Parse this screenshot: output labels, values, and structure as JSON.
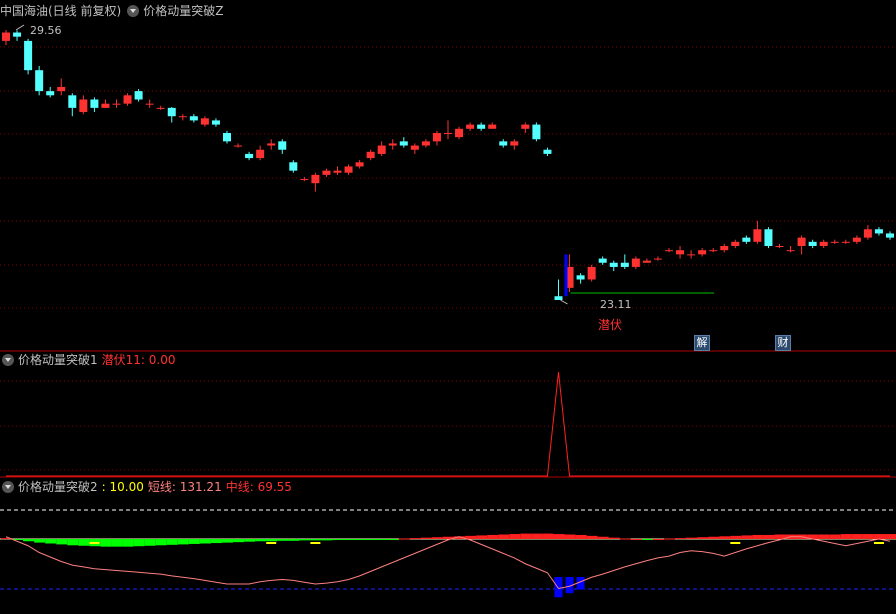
{
  "panel1": {
    "title": "中国海油(日线 前复权)",
    "indicator": "价格动量突破Z",
    "high_label": "29.56",
    "low_label": "23.11",
    "signal_text": "潜伏",
    "event_tags": [
      "解",
      "财"
    ]
  },
  "panel2": {
    "indicator": "价格动量突破1",
    "value_label": "潜伏11: 0.00"
  },
  "panel3": {
    "indicator": "价格动量突破2",
    "v1": ": 10.00",
    "v2_label": "短线: 131.21",
    "v3_label": "中线: 69.55"
  },
  "colors": {
    "up": "#ff3232",
    "down": "#54ffff",
    "bull": "#ff2020",
    "bear": "#00ff00",
    "grid": "#7f0000",
    "short": "#ff8080",
    "blue": "#0000ff"
  },
  "chart_data": [
    {
      "type": "candlestick",
      "ylim": [
        23.11,
        29.56
      ],
      "high": 29.56,
      "low": 23.11,
      "candles": [
        [
          29.3,
          29.5,
          29.2,
          29.56
        ],
        [
          29.5,
          29.4,
          29.3,
          29.55
        ],
        [
          29.3,
          28.6,
          28.5,
          29.35
        ],
        [
          28.6,
          28.1,
          28.0,
          28.7
        ],
        [
          28.1,
          28.0,
          27.95,
          28.2
        ],
        [
          28.1,
          28.2,
          28.0,
          28.4
        ],
        [
          28.0,
          27.7,
          27.5,
          28.05
        ],
        [
          27.6,
          27.9,
          27.55,
          28.0
        ],
        [
          27.9,
          27.7,
          27.6,
          27.95
        ],
        [
          27.7,
          27.8,
          27.7,
          27.9
        ],
        [
          27.8,
          27.8,
          27.7,
          27.9
        ],
        [
          27.8,
          28.0,
          27.75,
          28.05
        ],
        [
          28.1,
          27.9,
          27.85,
          28.15
        ],
        [
          27.8,
          27.8,
          27.7,
          27.9
        ],
        [
          27.7,
          27.7,
          27.65,
          27.75
        ],
        [
          27.7,
          27.5,
          27.35,
          27.72
        ],
        [
          27.5,
          27.5,
          27.4,
          27.55
        ],
        [
          27.5,
          27.4,
          27.35,
          27.55
        ],
        [
          27.3,
          27.45,
          27.25,
          27.5
        ],
        [
          27.4,
          27.3,
          27.25,
          27.45
        ],
        [
          27.1,
          26.9,
          26.85,
          27.15
        ],
        [
          26.8,
          26.8,
          26.75,
          26.85
        ],
        [
          26.6,
          26.5,
          26.45,
          26.65
        ],
        [
          26.5,
          26.7,
          26.45,
          26.8
        ],
        [
          26.8,
          26.85,
          26.7,
          26.95
        ],
        [
          26.9,
          26.7,
          26.6,
          26.95
        ],
        [
          26.4,
          26.2,
          26.15,
          26.45
        ],
        [
          26.0,
          26.0,
          25.95,
          26.05
        ],
        [
          25.9,
          26.1,
          25.7,
          26.15
        ],
        [
          26.1,
          26.2,
          26.05,
          26.25
        ],
        [
          26.15,
          26.2,
          26.1,
          26.3
        ],
        [
          26.15,
          26.3,
          26.1,
          26.35
        ],
        [
          26.3,
          26.4,
          26.25,
          26.45
        ],
        [
          26.5,
          26.65,
          26.45,
          26.7
        ],
        [
          26.6,
          26.8,
          26.55,
          26.9
        ],
        [
          26.8,
          26.85,
          26.7,
          26.95
        ],
        [
          26.9,
          26.8,
          26.75,
          27.0
        ],
        [
          26.7,
          26.8,
          26.6,
          26.85
        ],
        [
          26.8,
          26.9,
          26.75,
          26.95
        ],
        [
          26.9,
          27.1,
          26.8,
          27.15
        ],
        [
          27.1,
          27.1,
          26.95,
          27.4
        ],
        [
          27.0,
          27.2,
          26.95,
          27.25
        ],
        [
          27.2,
          27.3,
          27.15,
          27.35
        ],
        [
          27.3,
          27.2,
          27.15,
          27.35
        ],
        [
          27.2,
          27.3,
          27.2,
          27.35
        ],
        [
          26.9,
          26.8,
          26.75,
          26.95
        ],
        [
          26.8,
          26.9,
          26.7,
          26.95
        ],
        [
          27.2,
          27.3,
          27.1,
          27.35
        ],
        [
          27.3,
          26.95,
          26.9,
          27.35
        ],
        [
          26.7,
          26.6,
          26.55,
          26.75
        ],
        [
          23.2,
          23.11,
          23.11,
          23.6
        ],
        [
          23.4,
          23.9,
          23.3,
          24.2
        ],
        [
          23.7,
          23.6,
          23.5,
          23.75
        ],
        [
          23.6,
          23.9,
          23.55,
          23.95
        ],
        [
          24.1,
          24.0,
          23.95,
          24.15
        ],
        [
          24.0,
          23.9,
          23.8,
          24.05
        ],
        [
          24.0,
          23.9,
          23.85,
          24.2
        ],
        [
          23.9,
          24.1,
          23.85,
          24.15
        ],
        [
          24.0,
          24.05,
          24.0,
          24.1
        ],
        [
          24.1,
          24.1,
          24.05,
          24.15
        ],
        [
          24.3,
          24.3,
          24.25,
          24.35
        ],
        [
          24.2,
          24.3,
          24.1,
          24.4
        ],
        [
          24.2,
          24.2,
          24.1,
          24.3
        ],
        [
          24.2,
          24.3,
          24.15,
          24.35
        ],
        [
          24.3,
          24.3,
          24.25,
          24.35
        ],
        [
          24.3,
          24.4,
          24.25,
          24.45
        ],
        [
          24.4,
          24.5,
          24.35,
          24.55
        ],
        [
          24.6,
          24.5,
          24.45,
          24.65
        ],
        [
          24.5,
          24.8,
          24.45,
          25.0
        ],
        [
          24.8,
          24.4,
          24.35,
          24.85
        ],
        [
          24.4,
          24.4,
          24.35,
          24.45
        ],
        [
          24.3,
          24.3,
          24.25,
          24.4
        ],
        [
          24.4,
          24.6,
          24.2,
          24.65
        ],
        [
          24.5,
          24.4,
          24.35,
          24.55
        ],
        [
          24.4,
          24.5,
          24.35,
          24.55
        ],
        [
          24.5,
          24.5,
          24.45,
          24.55
        ],
        [
          24.5,
          24.5,
          24.45,
          24.55
        ],
        [
          24.5,
          24.6,
          24.45,
          24.65
        ],
        [
          24.6,
          24.8,
          24.55,
          24.9
        ],
        [
          24.8,
          24.7,
          24.65,
          24.85
        ],
        [
          24.7,
          24.6,
          24.55,
          24.75
        ]
      ]
    },
    {
      "type": "line",
      "series": [
        {
          "name": "潜伏11",
          "values": [
            0,
            0,
            0,
            0,
            0,
            0,
            0,
            0,
            0,
            0,
            0,
            0,
            0,
            0,
            0,
            0,
            0,
            0,
            0,
            0,
            0,
            0,
            0,
            0,
            0,
            0,
            0,
            0,
            0,
            0,
            0,
            0,
            0,
            0,
            0,
            0,
            0,
            0,
            0,
            0,
            0,
            0,
            0,
            0,
            0,
            0,
            0,
            0,
            0,
            0,
            1,
            0,
            0,
            0,
            0,
            0,
            0,
            0,
            0,
            0,
            0,
            0,
            0,
            0,
            0,
            0,
            0,
            0,
            0,
            0,
            0,
            0,
            0,
            0,
            0,
            0,
            0,
            0,
            0,
            0,
            0
          ]
        }
      ],
      "ylim": [
        0,
        1
      ]
    },
    {
      "type": "bar",
      "series": [
        {
          "name": "中线",
          "values": [
            2,
            -2,
            -5,
            -8,
            -10,
            -12,
            -14,
            -15,
            -16,
            -17,
            -17,
            -17,
            -16,
            -15,
            -14,
            -13,
            -12,
            -11,
            -10,
            -9,
            -8,
            -7,
            -6,
            -5,
            -5,
            -4,
            -4,
            -3,
            -3,
            -3,
            -2,
            -2,
            -2,
            -2,
            -1,
            -1,
            1,
            2,
            3,
            4,
            5,
            6,
            7,
            8,
            9,
            10,
            11,
            12,
            12,
            12,
            11,
            10,
            9,
            7,
            5,
            3,
            1,
            0,
            -1,
            0,
            1,
            2,
            3,
            4,
            5,
            6,
            7,
            8,
            9,
            9,
            10,
            10,
            10,
            10,
            10,
            10,
            11,
            11,
            11,
            11,
            11
          ]
        },
        {
          "name": "短线",
          "values": [
            5,
            -5,
            -15,
            -30,
            -40,
            -50,
            -58,
            -62,
            -66,
            -68,
            -70,
            -72,
            -74,
            -76,
            -78,
            -82,
            -85,
            -88,
            -92,
            -96,
            -100,
            -100,
            -100,
            -95,
            -92,
            -90,
            -92,
            -96,
            -100,
            -98,
            -95,
            -90,
            -82,
            -72,
            -62,
            -52,
            -42,
            -32,
            -22,
            -12,
            -2,
            5,
            -2,
            -12,
            -22,
            -32,
            -42,
            -55,
            -65,
            -75,
            -110,
            -105,
            -95,
            -85,
            -78,
            -70,
            -62,
            -55,
            -48,
            -42,
            -38,
            -30,
            -26,
            -28,
            -32,
            -38,
            -30,
            -22,
            -15,
            -8,
            -2,
            5,
            5,
            0,
            -5,
            -10,
            -15,
            -10,
            -5,
            0,
            -5
          ]
        },
        {
          "name": "blue",
          "values": [
            0,
            0,
            0,
            0,
            0,
            0,
            0,
            0,
            0,
            0,
            0,
            0,
            0,
            0,
            0,
            0,
            0,
            0,
            0,
            0,
            0,
            0,
            0,
            0,
            0,
            0,
            0,
            0,
            0,
            0,
            0,
            0,
            0,
            0,
            0,
            0,
            0,
            0,
            0,
            0,
            0,
            0,
            0,
            0,
            0,
            0,
            0,
            0,
            0,
            0,
            -45,
            -36,
            -28,
            0,
            0,
            0,
            0,
            0,
            0,
            0,
            0,
            0,
            0,
            0,
            0,
            0,
            0,
            0,
            0,
            0,
            0,
            0,
            0,
            0,
            0,
            0,
            0,
            0,
            0,
            0,
            0
          ]
        }
      ]
    }
  ]
}
